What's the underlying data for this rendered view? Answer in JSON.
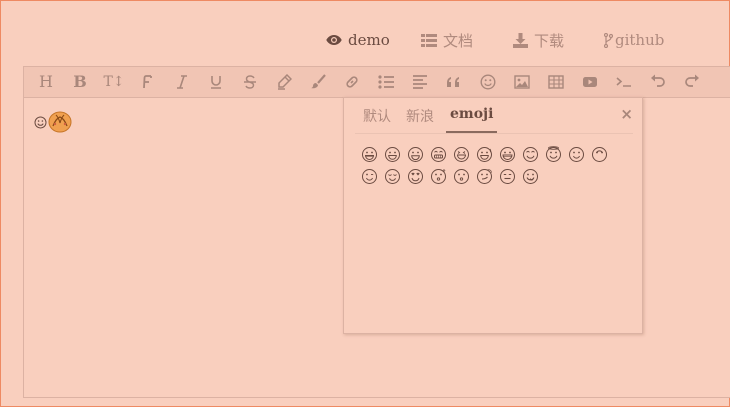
{
  "nav": {
    "items": [
      {
        "label": "demo",
        "icon": "eye-icon",
        "active": true
      },
      {
        "label": "文档",
        "icon": "list-icon",
        "active": false
      },
      {
        "label": "下载",
        "icon": "download-icon",
        "active": false
      },
      {
        "label": "github",
        "icon": "branch-icon",
        "active": false
      }
    ]
  },
  "toolbar": {
    "tools": [
      "heading",
      "bold",
      "text-size",
      "font",
      "italic",
      "underline",
      "strikethrough",
      "highlight",
      "brush",
      "link",
      "list",
      "align",
      "quote",
      "emoji",
      "image",
      "table",
      "video",
      "code",
      "undo",
      "redo"
    ],
    "heading_label": "H",
    "bold_label": "B",
    "textsize_label": "T↕"
  },
  "editor": {
    "inserted": [
      "smiley-emoji",
      "bun-emoji"
    ]
  },
  "emoji_dialog": {
    "tabs": [
      "默认",
      "新浪",
      "emoji"
    ],
    "active_tab": "emoji",
    "close_label": "×",
    "emojis": [
      "grinning",
      "smiley",
      "smile",
      "grin",
      "laughing",
      "sweat-smile",
      "joy",
      "blush",
      "innocent",
      "slightly-smiling",
      "upside-down",
      "wink",
      "relieved",
      "heart-eyes",
      "kissing-heart",
      "kissing",
      "smirk",
      "expressionless",
      "yum"
    ]
  },
  "colors": {
    "background": "#f9cfbe",
    "border": "#ee8a63",
    "text": "#6b4b41",
    "muted": "#b08a7e"
  }
}
